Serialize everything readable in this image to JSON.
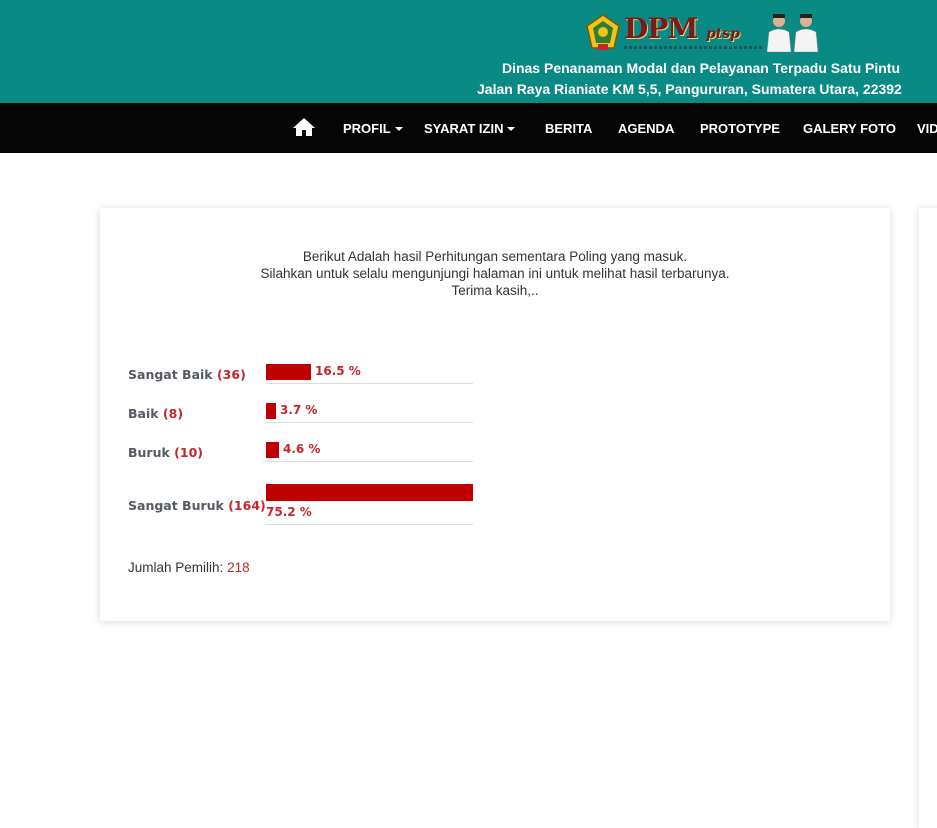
{
  "header": {
    "logo_text": "DPM",
    "logo_suffix": "ptsp",
    "agency_name": "Dinas Penanaman Modal dan Pelayanan Terpadu Satu Pintu",
    "address": "Jalan Raya Rianiate KM 5,5, Pangururan, Sumatera Utara, 22392",
    "colors": {
      "header_bg": "#0a8a85",
      "nav_bg": "#050505",
      "accent": "#c00000"
    }
  },
  "nav": {
    "home_icon": "home-icon",
    "items": [
      {
        "label": "PROFIL",
        "dropdown": true
      },
      {
        "label": "SYARAT IZIN",
        "dropdown": true
      },
      {
        "label": "BERITA",
        "dropdown": false
      },
      {
        "label": "AGENDA",
        "dropdown": false
      },
      {
        "label": "PROTOTYPE",
        "dropdown": false
      },
      {
        "label": "GALERY FOTO",
        "dropdown": false
      },
      {
        "label": "VID",
        "dropdown": false
      }
    ]
  },
  "poll": {
    "intro_line1": "Berikut Adalah hasil Perhitungan sementara Poling yang masuk.",
    "intro_line2": "Silahkan untuk selalu mengunjungi halaman ini untuk melihat hasil terbarunya.",
    "intro_line3": "Terima kasih,..",
    "results": [
      {
        "label": "Sangat Baik",
        "count": "(36)",
        "percent_text": "16.5 %",
        "percent": 16.5
      },
      {
        "label": "Baik",
        "count": "(8)",
        "percent_text": "3.7 %",
        "percent": 3.7
      },
      {
        "label": "Buruk",
        "count": "(10)",
        "percent_text": "4.6 %",
        "percent": 4.6
      },
      {
        "label": "Sangat Buruk",
        "count": "(164)",
        "percent_text": "75.2 %",
        "percent": 75.2
      }
    ],
    "total_label": "Jumlah Pemilih:",
    "total_value": "218"
  }
}
